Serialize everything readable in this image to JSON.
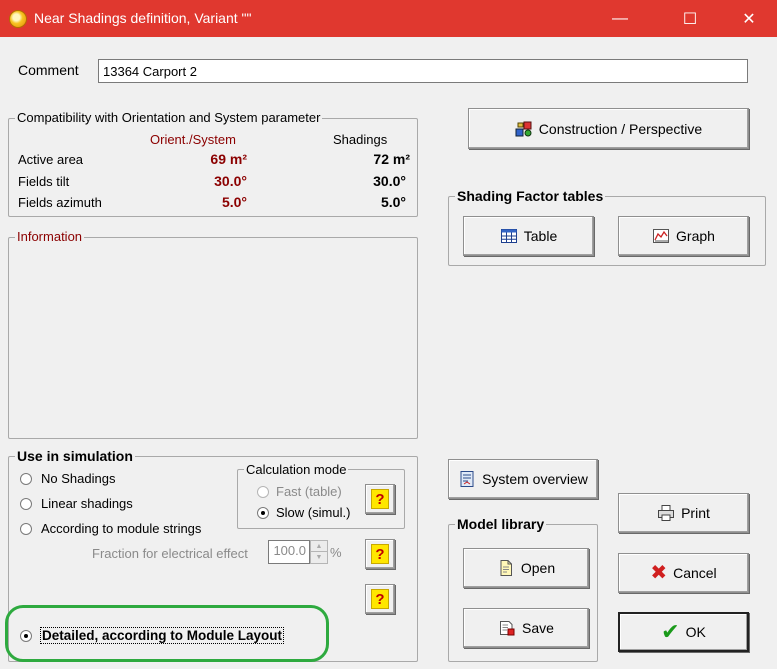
{
  "window": {
    "title": "Near Shadings definition, Variant \"\"",
    "minimize_glyph": "—",
    "maximize_glyph": "☐",
    "close_glyph": "✕"
  },
  "comment": {
    "label": "Comment",
    "value": "13364 Carport 2"
  },
  "compat": {
    "title": "Compatibility with Orientation and System parameter",
    "col_orient": "Orient./System",
    "col_shadings": "Shadings",
    "rows": [
      {
        "label": "Active area",
        "orient": "69 m²",
        "shadings": "72 m²"
      },
      {
        "label": "Fields tilt",
        "orient": "30.0°",
        "shadings": "30.0°"
      },
      {
        "label": "Fields azimuth",
        "orient": "5.0°",
        "shadings": "5.0°"
      }
    ]
  },
  "information": {
    "title": "Information"
  },
  "construction_button": {
    "label": "Construction / Perspective"
  },
  "shading_tables": {
    "title": "Shading Factor tables",
    "table_label": "Table",
    "graph_label": "Graph"
  },
  "simulation": {
    "title": "Use in simulation",
    "options": [
      {
        "label": "No Shadings",
        "checked": false
      },
      {
        "label": "Linear shadings",
        "checked": false
      },
      {
        "label": "According to module strings",
        "checked": false
      },
      {
        "label": "Detailed, according to Module Layout",
        "checked": true
      }
    ],
    "fraction_label": "Fraction for electrical effect",
    "fraction_value": "100.0",
    "fraction_unit": "%",
    "calc_mode": {
      "title": "Calculation mode",
      "fast_label": "Fast (table)",
      "slow_label": "Slow (simul.)"
    },
    "help_glyph": "?"
  },
  "system_overview": {
    "label": "System overview"
  },
  "model_library": {
    "title": "Model library",
    "open_label": "Open",
    "save_label": "Save"
  },
  "actions": {
    "print_label": "Print",
    "cancel_label": "Cancel",
    "ok_label": "OK"
  },
  "highlight_color": "#2eaa3f"
}
